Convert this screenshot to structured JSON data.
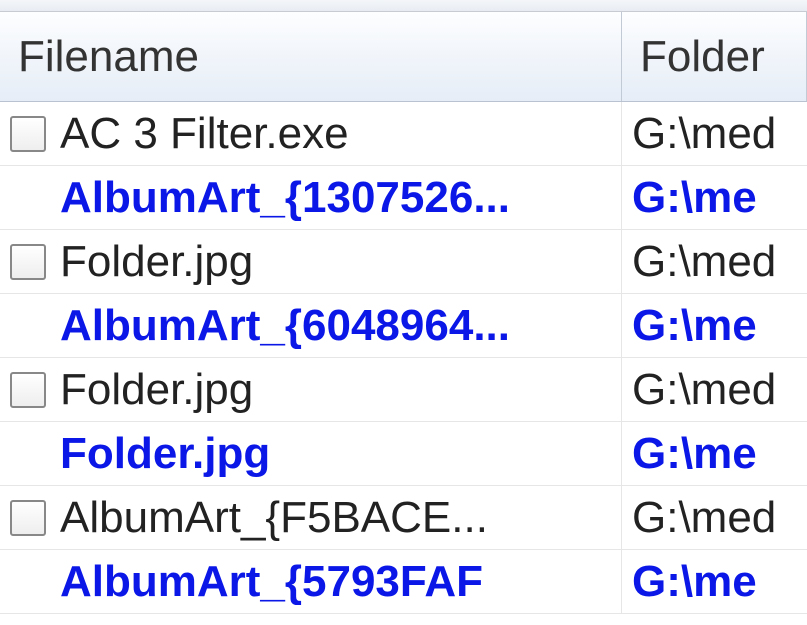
{
  "columns": {
    "filename": "Filename",
    "folder": "Folder"
  },
  "rows": [
    {
      "filename": "AC 3 Filter.exe",
      "folder": "G:\\med",
      "selected": false,
      "checkbox": true
    },
    {
      "filename": "AlbumArt_{1307526...",
      "folder": "G:\\me",
      "selected": true,
      "checkbox": false
    },
    {
      "filename": "Folder.jpg",
      "folder": "G:\\med",
      "selected": false,
      "checkbox": true
    },
    {
      "filename": "AlbumArt_{6048964...",
      "folder": "G:\\me",
      "selected": true,
      "checkbox": false
    },
    {
      "filename": "Folder.jpg",
      "folder": "G:\\med",
      "selected": false,
      "checkbox": true
    },
    {
      "filename": "Folder.jpg",
      "folder": "G:\\me",
      "selected": true,
      "checkbox": false
    },
    {
      "filename": "AlbumArt_{F5BACE...",
      "folder": "G:\\med",
      "selected": false,
      "checkbox": true
    },
    {
      "filename": "AlbumArt_{5793FAF",
      "folder": "G:\\me",
      "selected": true,
      "checkbox": false
    }
  ]
}
